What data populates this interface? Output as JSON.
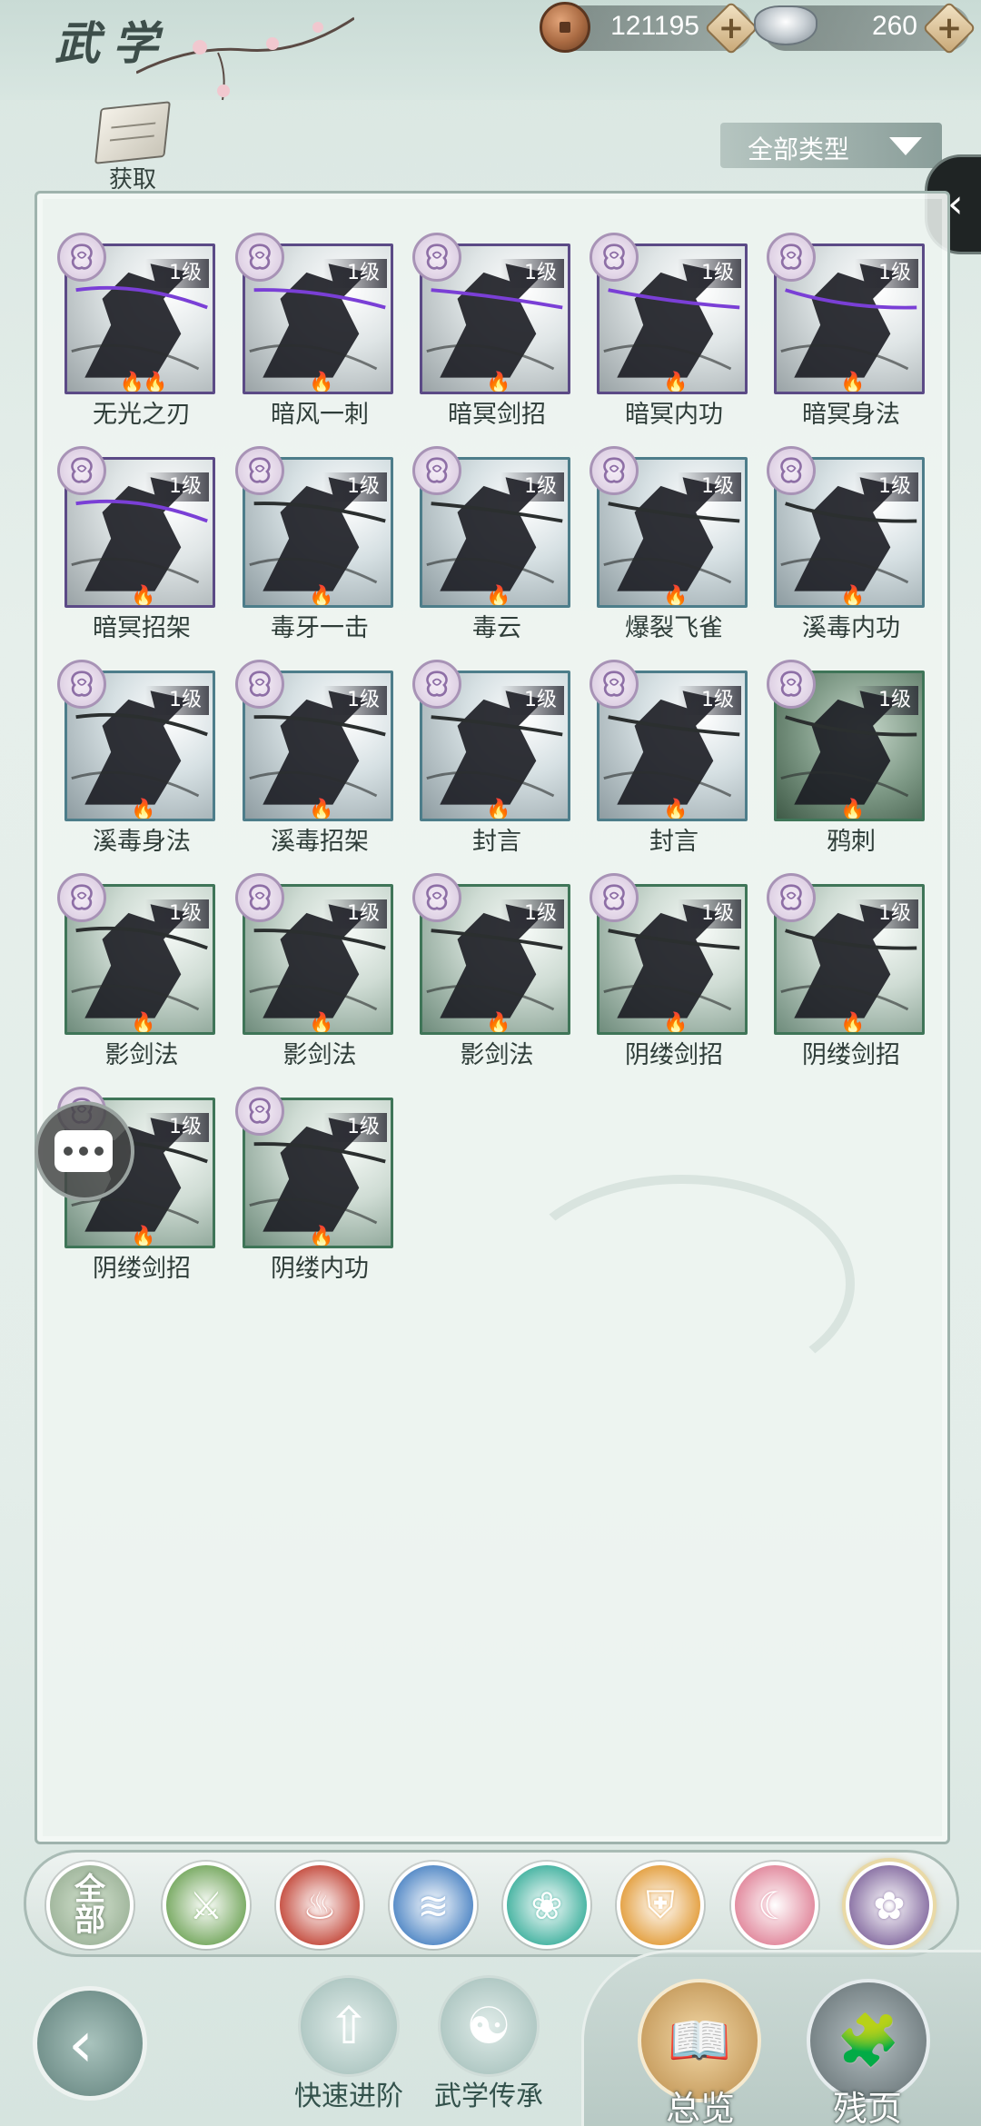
{
  "header": {
    "title": "武学",
    "coin_value": "121195",
    "silver_value": "260",
    "plus_label": "+"
  },
  "acquire": {
    "label": "获取"
  },
  "filter": {
    "selected": "全部类型"
  },
  "level_text": "1级",
  "skills": [
    {
      "name": "无光之刃",
      "level": "1级",
      "frame": "purple",
      "flames": "🔥🔥"
    },
    {
      "name": "暗风一刺",
      "level": "1级",
      "frame": "purple",
      "flames": "🔥"
    },
    {
      "name": "暗冥剑招",
      "level": "1级",
      "frame": "purple",
      "flames": "🔥"
    },
    {
      "name": "暗冥内功",
      "level": "1级",
      "frame": "purple",
      "flames": "🔥"
    },
    {
      "name": "暗冥身法",
      "level": "1级",
      "frame": "purple",
      "flames": "🔥"
    },
    {
      "name": "暗冥招架",
      "level": "1级",
      "frame": "purple",
      "flames": "🔥"
    },
    {
      "name": "毒牙一击",
      "level": "1级",
      "frame": "teal",
      "flames": "🔥"
    },
    {
      "name": "毒云",
      "level": "1级",
      "frame": "teal",
      "flames": "🔥"
    },
    {
      "name": "爆裂飞雀",
      "level": "1级",
      "frame": "teal",
      "flames": "🔥"
    },
    {
      "name": "溪毒内功",
      "level": "1级",
      "frame": "teal",
      "flames": "🔥"
    },
    {
      "name": "溪毒身法",
      "level": "1级",
      "frame": "teal",
      "flames": "🔥"
    },
    {
      "name": "溪毒招架",
      "level": "1级",
      "frame": "teal",
      "flames": "🔥"
    },
    {
      "name": "封言",
      "level": "1级",
      "frame": "teal",
      "flames": "🔥"
    },
    {
      "name": "封言",
      "level": "1级",
      "frame": "teal",
      "flames": "🔥"
    },
    {
      "name": "鸦刺",
      "level": "1级",
      "frame": "jade",
      "flames": "🔥"
    },
    {
      "name": "影剑法",
      "level": "1级",
      "frame": "green",
      "flames": "🔥"
    },
    {
      "name": "影剑法",
      "level": "1级",
      "frame": "green",
      "flames": "🔥"
    },
    {
      "name": "影剑法",
      "level": "1级",
      "frame": "green",
      "flames": "🔥"
    },
    {
      "name": "阴缕剑招",
      "level": "1级",
      "frame": "green",
      "flames": "🔥"
    },
    {
      "name": "阴缕剑招",
      "level": "1级",
      "frame": "green",
      "flames": "🔥"
    },
    {
      "name": "阴缕剑招",
      "level": "1级",
      "frame": "green",
      "flames": "🔥"
    },
    {
      "name": "阴缕内功",
      "level": "1级",
      "frame": "green",
      "flames": "🔥"
    }
  ],
  "element_filters": [
    {
      "icon": "all-icon",
      "label_top": "全",
      "label_bottom": "部"
    },
    {
      "icon": "bamboo-icon",
      "color": "#7fae6a"
    },
    {
      "icon": "fire-icon",
      "color": "#c8574a"
    },
    {
      "icon": "wave-icon",
      "color": "#5c8fc9"
    },
    {
      "icon": "butterfly-icon",
      "color": "#4fb7a6"
    },
    {
      "icon": "shield-icon",
      "color": "#e5a54b"
    },
    {
      "icon": "moon-icon",
      "color": "#e38fa2"
    },
    {
      "icon": "rose-icon",
      "color": "#8f78a8"
    }
  ],
  "bottom_nav": {
    "quick_advance": "快速进阶",
    "inheritance": "武学传承",
    "overview": "总览",
    "remnant": "残页"
  },
  "colors": {
    "accent": "#5b4a86",
    "gold": "#c9a877",
    "background": "#e3ede9"
  }
}
